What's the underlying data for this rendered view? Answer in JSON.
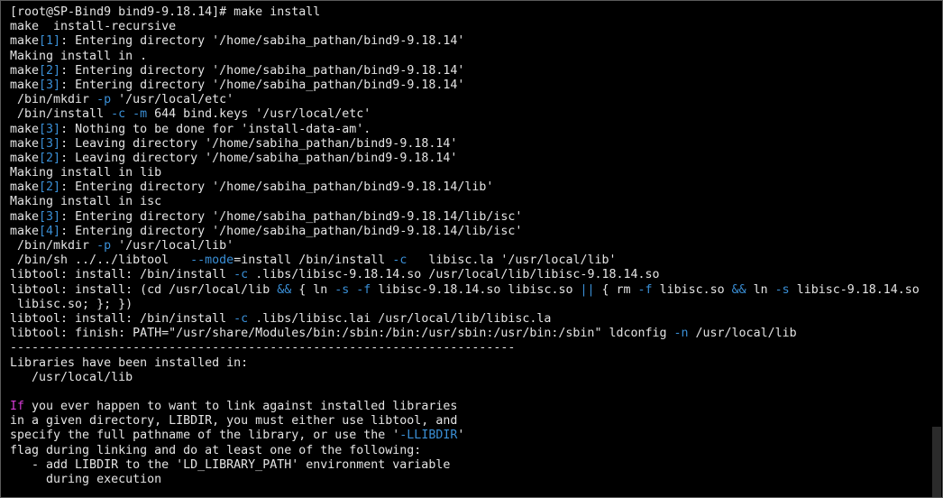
{
  "terminal": {
    "colors": {
      "background": "#000000",
      "text": "#d8d8d8",
      "option": "#3a8fd6",
      "keyword": "#d33ad3"
    },
    "lines": [
      [
        {
          "t": "[root@SP-Bind9 bind9-9.18.14]# make install",
          "c": "w"
        }
      ],
      [
        {
          "t": "make  install-recursive",
          "c": "w"
        }
      ],
      [
        {
          "t": "make",
          "c": "w"
        },
        {
          "t": "[1]",
          "c": "b"
        },
        {
          "t": ": Entering directory '/home/sabiha_pathan/bind9-9.18.14'",
          "c": "w"
        }
      ],
      [
        {
          "t": "Making install in .",
          "c": "w"
        }
      ],
      [
        {
          "t": "make",
          "c": "w"
        },
        {
          "t": "[2]",
          "c": "b"
        },
        {
          "t": ": Entering directory '/home/sabiha_pathan/bind9-9.18.14'",
          "c": "w"
        }
      ],
      [
        {
          "t": "make",
          "c": "w"
        },
        {
          "t": "[3]",
          "c": "b"
        },
        {
          "t": ": Entering directory '/home/sabiha_pathan/bind9-9.18.14'",
          "c": "w"
        }
      ],
      [
        {
          "t": " /bin/mkdir ",
          "c": "w"
        },
        {
          "t": "-p",
          "c": "b"
        },
        {
          "t": " '/usr/local/etc'",
          "c": "w"
        }
      ],
      [
        {
          "t": " /bin/install ",
          "c": "w"
        },
        {
          "t": "-c",
          "c": "b"
        },
        {
          "t": " ",
          "c": "w"
        },
        {
          "t": "-m",
          "c": "b"
        },
        {
          "t": " 644 bind.keys '/usr/local/etc'",
          "c": "w"
        }
      ],
      [
        {
          "t": "make",
          "c": "w"
        },
        {
          "t": "[3]",
          "c": "b"
        },
        {
          "t": ": Nothing to be done for 'install-data-am'.",
          "c": "w"
        }
      ],
      [
        {
          "t": "make",
          "c": "w"
        },
        {
          "t": "[3]",
          "c": "b"
        },
        {
          "t": ": Leaving directory '/home/sabiha_pathan/bind9-9.18.14'",
          "c": "w"
        }
      ],
      [
        {
          "t": "make",
          "c": "w"
        },
        {
          "t": "[2]",
          "c": "b"
        },
        {
          "t": ": Leaving directory '/home/sabiha_pathan/bind9-9.18.14'",
          "c": "w"
        }
      ],
      [
        {
          "t": "Making install in lib",
          "c": "w"
        }
      ],
      [
        {
          "t": "make",
          "c": "w"
        },
        {
          "t": "[2]",
          "c": "b"
        },
        {
          "t": ": Entering directory '/home/sabiha_pathan/bind9-9.18.14/lib'",
          "c": "w"
        }
      ],
      [
        {
          "t": "Making install in isc",
          "c": "w"
        }
      ],
      [
        {
          "t": "make",
          "c": "w"
        },
        {
          "t": "[3]",
          "c": "b"
        },
        {
          "t": ": Entering directory '/home/sabiha_pathan/bind9-9.18.14/lib/isc'",
          "c": "w"
        }
      ],
      [
        {
          "t": "make",
          "c": "w"
        },
        {
          "t": "[4]",
          "c": "b"
        },
        {
          "t": ": Entering directory '/home/sabiha_pathan/bind9-9.18.14/lib/isc'",
          "c": "w"
        }
      ],
      [
        {
          "t": " /bin/mkdir ",
          "c": "w"
        },
        {
          "t": "-p",
          "c": "b"
        },
        {
          "t": " '/usr/local/lib'",
          "c": "w"
        }
      ],
      [
        {
          "t": " /bin/sh ../../libtool   ",
          "c": "w"
        },
        {
          "t": "--mode",
          "c": "b"
        },
        {
          "t": "=install /bin/install ",
          "c": "w"
        },
        {
          "t": "-c",
          "c": "b"
        },
        {
          "t": "   libisc.la '/usr/local/lib'",
          "c": "w"
        }
      ],
      [
        {
          "t": "libtool: install: /bin/install ",
          "c": "w"
        },
        {
          "t": "-c",
          "c": "b"
        },
        {
          "t": " .libs/libisc-9.18.14.so /usr/local/lib/libisc-9.18.14.so",
          "c": "w"
        }
      ],
      [
        {
          "t": "libtool: install: (cd /usr/local/lib ",
          "c": "w"
        },
        {
          "t": "&&",
          "c": "b"
        },
        {
          "t": " { ln ",
          "c": "w"
        },
        {
          "t": "-s",
          "c": "b"
        },
        {
          "t": " ",
          "c": "w"
        },
        {
          "t": "-f",
          "c": "b"
        },
        {
          "t": " libisc-9.18.14.so libisc.so ",
          "c": "w"
        },
        {
          "t": "||",
          "c": "b"
        },
        {
          "t": " { rm ",
          "c": "w"
        },
        {
          "t": "-f",
          "c": "b"
        },
        {
          "t": " libisc.so ",
          "c": "w"
        },
        {
          "t": "&&",
          "c": "b"
        },
        {
          "t": " ln ",
          "c": "w"
        },
        {
          "t": "-s",
          "c": "b"
        },
        {
          "t": " libisc-9.18.14.so",
          "c": "w"
        }
      ],
      [
        {
          "t": " libisc.so; }; })",
          "c": "w"
        }
      ],
      [
        {
          "t": "libtool: install: /bin/install ",
          "c": "w"
        },
        {
          "t": "-c",
          "c": "b"
        },
        {
          "t": " .libs/libisc.lai /usr/local/lib/libisc.la",
          "c": "w"
        }
      ],
      [
        {
          "t": "libtool: finish: PATH=\"/usr/share/Modules/bin:/sbin:/bin:/usr/sbin:/usr/bin:/sbin\" ldconfig ",
          "c": "w"
        },
        {
          "t": "-n",
          "c": "b"
        },
        {
          "t": " /usr/local/lib",
          "c": "w"
        }
      ],
      [
        {
          "t": "----------------------------------------------------------------------",
          "c": "w"
        }
      ],
      [
        {
          "t": "Libraries have been installed in:",
          "c": "w"
        }
      ],
      [
        {
          "t": "   /usr/local/lib",
          "c": "w"
        }
      ],
      [
        {
          "t": "",
          "c": "w"
        }
      ],
      [
        {
          "t": "If",
          "c": "m"
        },
        {
          "t": " you ever happen to want to link against installed libraries",
          "c": "w"
        }
      ],
      [
        {
          "t": "in a given directory, LIBDIR, you must either use libtool, and",
          "c": "w"
        }
      ],
      [
        {
          "t": "specify the full pathname of the library, or use the '",
          "c": "w"
        },
        {
          "t": "-LLIBDIR",
          "c": "b"
        },
        {
          "t": "'",
          "c": "w"
        }
      ],
      [
        {
          "t": "flag during linking and do at least one of the following:",
          "c": "w"
        }
      ],
      [
        {
          "t": "   - add LIBDIR to the 'LD_LIBRARY_PATH' environment variable",
          "c": "w"
        }
      ],
      [
        {
          "t": "     during execution",
          "c": "w"
        }
      ]
    ]
  }
}
